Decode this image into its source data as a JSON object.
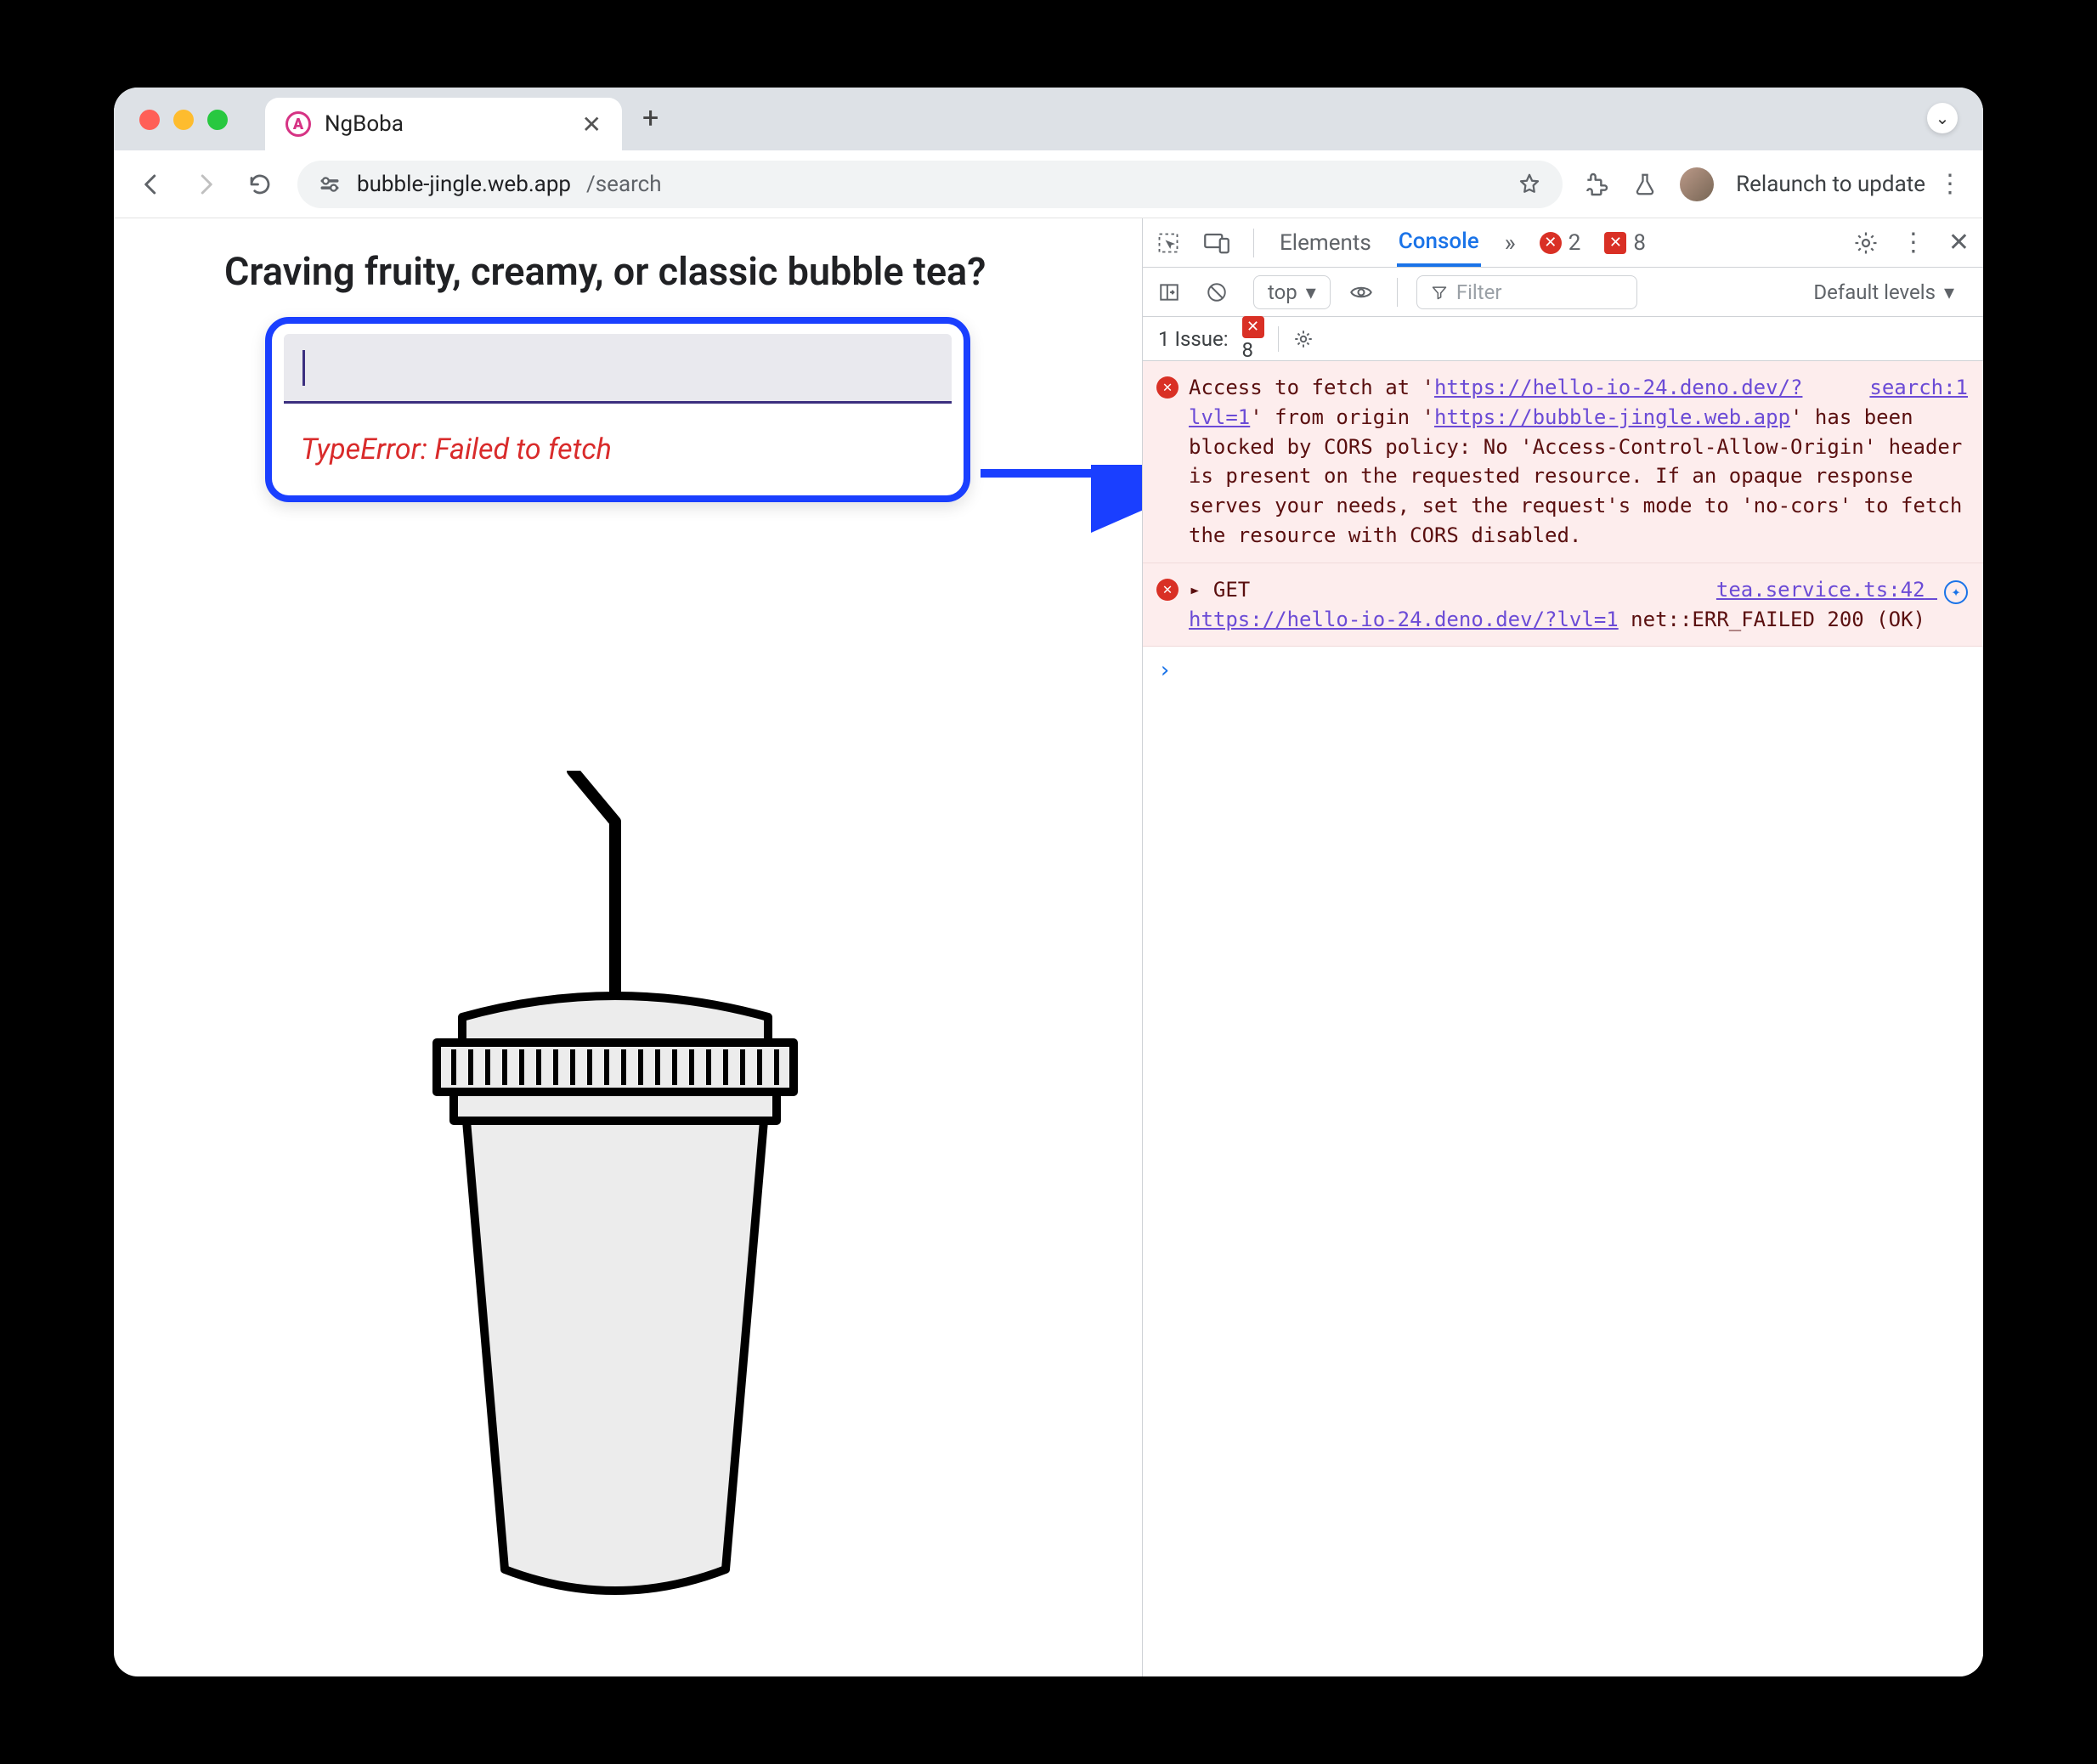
{
  "browser": {
    "tab_title": "NgBoba",
    "new_tab_tooltip": "+",
    "back": "←",
    "forward": "→",
    "reload": "⟳",
    "url_host": "bubble-jingle.web.app",
    "url_path": "/search",
    "relaunch_label": "Relaunch to update"
  },
  "page": {
    "heading": "Craving fruity, creamy, or classic bubble tea?",
    "search_value": "",
    "error_text": "TypeError: Failed to fetch"
  },
  "devtools": {
    "tabs": {
      "elements": "Elements",
      "console": "Console"
    },
    "overflow_label": "»",
    "error_count": "2",
    "warn_count": "8",
    "sub": {
      "context": "top",
      "filter_placeholder": "Filter",
      "levels": "Default levels"
    },
    "issues": {
      "label": "1 Issue:",
      "count": "8"
    },
    "msg1": {
      "source": "search:1",
      "p1": "Access to fetch at '",
      "url1": "https://hello-io-24.deno.dev/?lvl=1",
      "p2": "' from origin '",
      "url2": "https://bubble-jingle.web.app",
      "p3": "' has been blocked by CORS policy: No 'Access-Control-Allow-Origin' header is present on the requested resource. If an opaque response serves your needs, set the request's mode to 'no-cors' to fetch the resource with CORS disabled."
    },
    "msg2": {
      "source": "tea.service.ts:42",
      "method": "GET",
      "url": "https://hello-io-24.deno.dev/?lvl=1",
      "tail": " net::ERR_FAILED 200 (OK)"
    },
    "prompt": "›"
  }
}
